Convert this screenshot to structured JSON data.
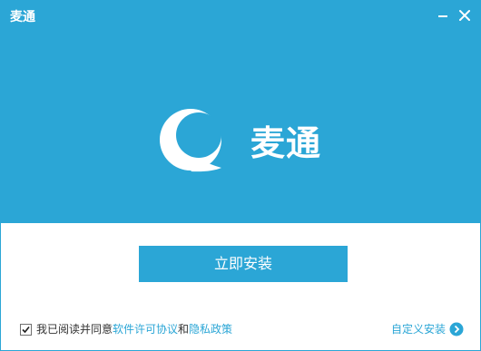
{
  "window": {
    "title": "麦通"
  },
  "logo": {
    "text": "麦通"
  },
  "install": {
    "label": "立即安装"
  },
  "agreement": {
    "checked": true,
    "prefix": "我已阅读并同意",
    "license_link": "软件许可协议",
    "conjunction": "和",
    "privacy_link": "隐私政策"
  },
  "custom_install": {
    "label": "自定义安装"
  },
  "icons": {
    "minimize": "minimize-icon",
    "close": "close-icon",
    "logo": "speech-bubble-logo-icon",
    "checkbox": "checkmark-icon",
    "arrow": "chevron-right-circle-icon"
  },
  "colors": {
    "brand": "#2ba6d6",
    "text": "#333333",
    "white": "#ffffff"
  }
}
